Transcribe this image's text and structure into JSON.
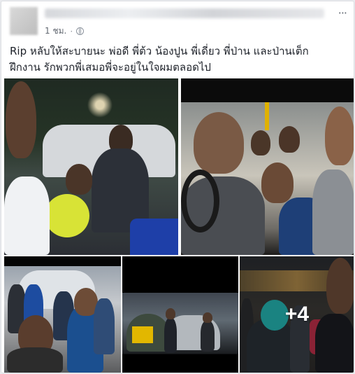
{
  "post": {
    "timestamp": "1 ชม.",
    "separator": "·",
    "text": "Rip หลับให้สะบายนะ พ่อดี พี่ต้ว น้องปูน พี่เดี่ยว พี่ป่าน และป่านเต็ก\nฝึกงาน รักพวกพี่เสมอพี่จะอยู่ในใจผมตลอดไป",
    "more_label": "···",
    "icons": {
      "privacy": "globe-icon",
      "menu": "more-options-icon"
    }
  },
  "photos": {
    "more_count": "+4"
  }
}
